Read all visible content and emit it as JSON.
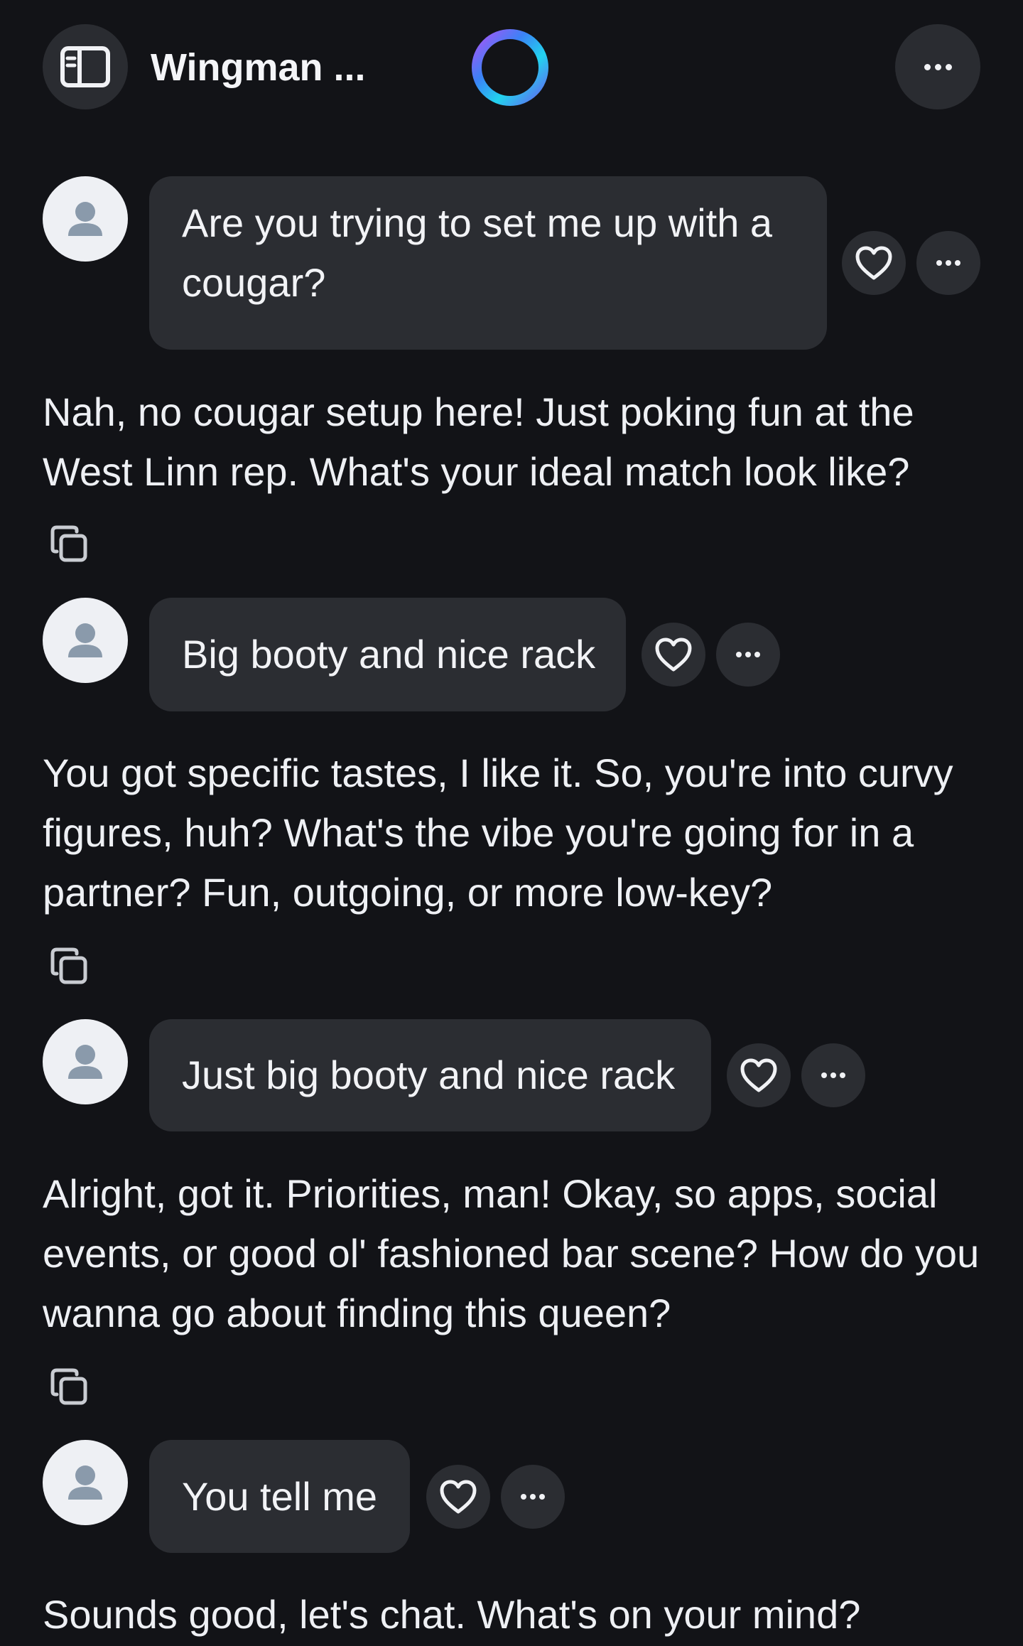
{
  "header": {
    "title": "Wingman ...",
    "sidebar_icon": "sidebar-panel-icon",
    "logo_icon": "assistant-ring-logo",
    "more_icon": "more-dots-icon"
  },
  "colors": {
    "background": "#121317",
    "bubble": "#2b2d32",
    "text": "#eef0f4",
    "logo_gradient": [
      "#3b82f6",
      "#22d3ee",
      "#a855f7",
      "#6366f1"
    ]
  },
  "messages": [
    {
      "role": "user",
      "text": "Are you trying to set me up with a cougar?"
    },
    {
      "role": "assistant",
      "text": "Nah, no cougar setup here! Just poking fun at the West Linn rep. What's your ideal match look like?"
    },
    {
      "role": "user",
      "text": "Big booty and nice rack"
    },
    {
      "role": "assistant",
      "text": "You got specific tastes, I like it. So, you're into curvy figures, huh? What's the vibe you're going for in a partner? Fun, outgoing, or more low-key?"
    },
    {
      "role": "user",
      "text": "Just big booty and nice rack"
    },
    {
      "role": "assistant",
      "text": "Alright, got it. Priorities, man! Okay, so apps, social events, or good ol' fashioned bar scene? How do you wanna go about finding this queen?"
    },
    {
      "role": "user",
      "text": "You tell me"
    },
    {
      "role": "assistant",
      "text": "Sounds good, let's chat. What's on your mind?"
    }
  ]
}
